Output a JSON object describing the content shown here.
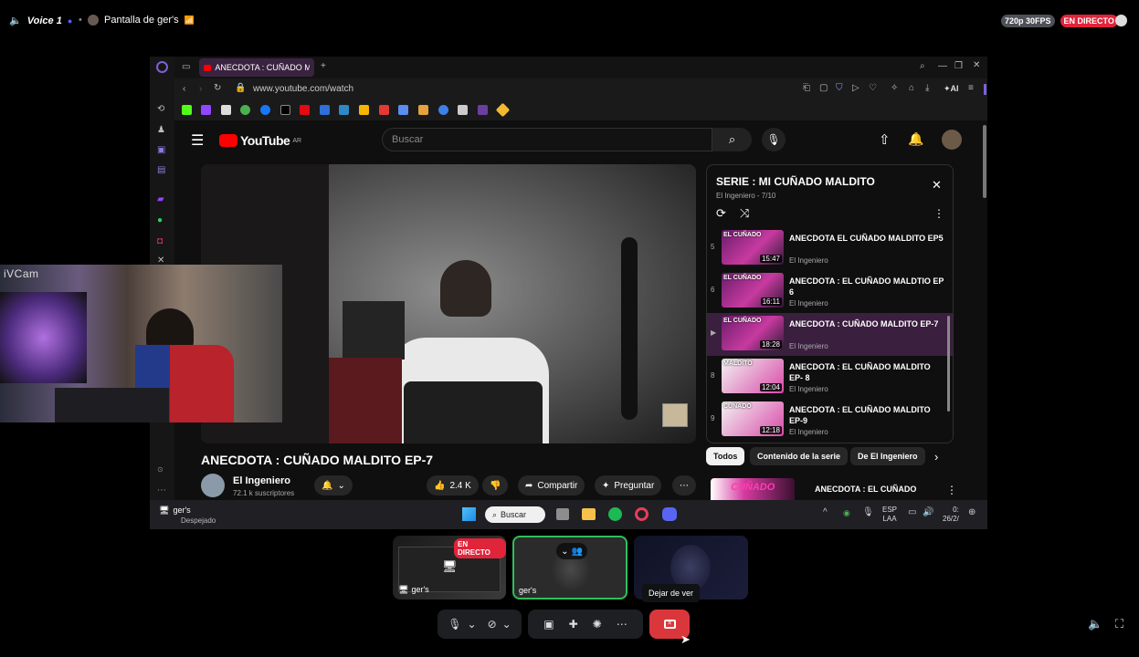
{
  "topbar": {
    "voice_channel": "Voice 1",
    "screen_share_title": "Pantalla de ger's",
    "quality_badge": "720p 30FPS",
    "live_badge": "EN DIRECTO"
  },
  "browser": {
    "tab_title": "ANECDOTA : CUÑADO MA",
    "new_tab": "+",
    "url": "www.youtube.com/watch",
    "ai_label": "AI"
  },
  "youtube": {
    "logo": "YouTube",
    "region": "AR",
    "search_placeholder": "Buscar",
    "video_title": "ANECDOTA : CUÑADO MALDITO EP-7",
    "channel_name": "El Ingeniero",
    "subscribers": "72.1 k suscriptores",
    "likes": "2.4 K",
    "share_label": "Compartir",
    "ask_label": "Preguntar",
    "playlist": {
      "title": "SERIE : MI CUÑADO MALDITO",
      "subtitle": "El Ingeniero - 7/10",
      "items": [
        {
          "index": "5",
          "title": "ANECDOTA EL CUÑADO MALDITO EP5",
          "channel": "El Ingeniero",
          "duration": "15:47",
          "tag": "EL CUÑADO"
        },
        {
          "index": "6",
          "title": "ANECDOTA : EL CUÑADO MALDTIO EP 6",
          "channel": "El Ingeniero",
          "duration": "16:11",
          "tag": "EL CUÑADO"
        },
        {
          "index": "▶",
          "title": "ANECDOTA : CUÑADO MALDITO EP-7",
          "channel": "El Ingeniero",
          "duration": "18:28",
          "tag": "EL CUÑADO"
        },
        {
          "index": "8",
          "title": "ANECDOTA : EL CUÑADO MALDITO EP- 8",
          "channel": "El Ingeniero",
          "duration": "12:04",
          "tag": "MALDITO"
        },
        {
          "index": "9",
          "title": "ANECDOTA : EL CUÑADO MALDITO EP-9",
          "channel": "El Ingeniero",
          "duration": "12:18",
          "tag": "CUÑADO"
        }
      ]
    },
    "chips": [
      "Todos",
      "Contenido de la serie",
      "De El Ingeniero"
    ],
    "next_rec_title": "ANECDOTA : EL CUÑADO",
    "next_rec_thumb": "CUÑADO"
  },
  "camera": {
    "label": "iVCam"
  },
  "taskbar": {
    "user": "ger's",
    "weather": "Despejado",
    "search": "Buscar",
    "lang1": "ESP",
    "lang2": "LAA",
    "time": "0:",
    "date": "26/2/"
  },
  "bottom": {
    "tile1_label": "ger's",
    "tile1_live": "EN DIRECTO",
    "tile2_label": "ger's",
    "tooltip": "Dejar de ver"
  },
  "colors": {
    "youtube_red": "#ff0000",
    "discord_red": "#da373c",
    "live_red": "#e0243a",
    "selected_row": "#3b1f3f",
    "active_tile_border": "#2fbf5b"
  }
}
